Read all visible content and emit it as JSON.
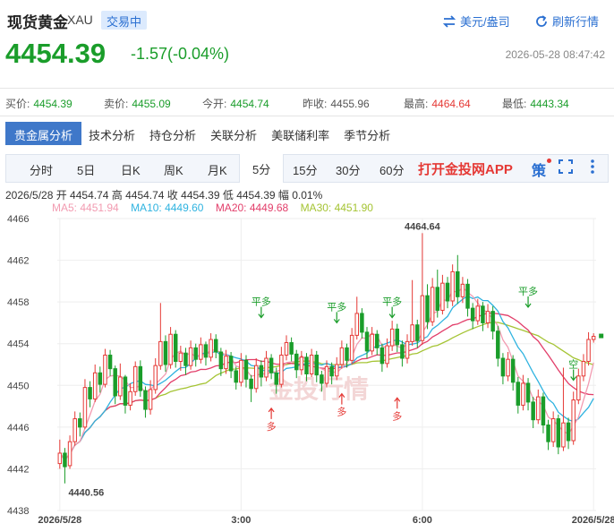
{
  "header": {
    "title": "现货黄金",
    "symbol": "XAU",
    "status": "交易中",
    "currency_link": "美元/盎司",
    "refresh_link": "刷新行情",
    "price": "4454.39",
    "change": "-1.57(-0.04%)",
    "datetime": "2026-05-28 08:47:42"
  },
  "quote": {
    "bid_label": "买价:",
    "bid": "4454.39",
    "ask_label": "卖价:",
    "ask": "4455.09",
    "open_label": "今开:",
    "open": "4454.74",
    "prev_label": "昨收:",
    "prev": "4455.96",
    "high_label": "最高:",
    "high": "4464.64",
    "low_label": "最低:",
    "low": "4443.34"
  },
  "tabs_analysis": [
    "贵金属分析",
    "技术分析",
    "持仓分析",
    "关联分析",
    "美联储利率",
    "季节分析"
  ],
  "tabs_period": [
    "分时",
    "5日",
    "日K",
    "周K",
    "月K",
    "5分",
    "15分",
    "30分",
    "60分"
  ],
  "app_link": "打开金投网APP",
  "strategy_label": "策",
  "info_line": "2026/5/28  开 4454.74  高 4454.74  收 4454.39  低 4454.39  幅 0.01%",
  "ma": {
    "ma5": "MA5: 4451.94",
    "ma10": "MA10: 4449.60",
    "ma20": "MA20: 4449.68",
    "ma30": "MA30: 4451.90"
  },
  "colors": {
    "up": "#e53935",
    "down": "#1a9d2a",
    "ma5": "#f29bb1",
    "ma10": "#2fb3e0",
    "ma20": "#e23e6a",
    "ma30": "#a5c434",
    "accent": "#2a6fd1"
  },
  "chart_data": {
    "type": "candlestick",
    "ylim": [
      4438,
      4466
    ],
    "yticks": [
      4438,
      4442,
      4446,
      4450,
      4454,
      4458,
      4462,
      4466
    ],
    "x_labels": [
      {
        "label": "2026/5/28",
        "index": 0
      },
      {
        "label": "3:00",
        "index": 36
      },
      {
        "label": "6:00",
        "index": 72
      },
      {
        "label": "2026/5/28",
        "index": 106
      }
    ],
    "max_label": "4464.64",
    "min_label": "4440.56",
    "signals": [
      {
        "text": "平多",
        "index": 40,
        "price": 4456.5,
        "dir": "down"
      },
      {
        "text": "平多",
        "index": 55,
        "price": 4456.0,
        "dir": "down"
      },
      {
        "text": "平多",
        "index": 66,
        "price": 4456.5,
        "dir": "down"
      },
      {
        "text": "平多",
        "index": 93,
        "price": 4457.5,
        "dir": "down"
      },
      {
        "text": "多",
        "index": 42,
        "price": 4447.8,
        "dir": "up"
      },
      {
        "text": "多",
        "index": 56,
        "price": 4449.2,
        "dir": "up"
      },
      {
        "text": "多",
        "index": 67,
        "price": 4448.8,
        "dir": "up"
      },
      {
        "text": "空",
        "index": 102,
        "price": 4450.5,
        "dir": "down"
      }
    ],
    "candles": [
      [
        4442.5,
        4443.5,
        4444.8,
        4442.0
      ],
      [
        4443.5,
        4442.2,
        4444.0,
        4440.6
      ],
      [
        4442.3,
        4444.6,
        4445.2,
        4442.0
      ],
      [
        4444.6,
        4446.8,
        4447.5,
        4444.2
      ],
      [
        4446.8,
        4446.0,
        4447.4,
        4445.1
      ],
      [
        4446.0,
        4449.8,
        4450.6,
        4445.8
      ],
      [
        4449.8,
        4448.7,
        4450.4,
        4447.9
      ],
      [
        4448.7,
        4451.2,
        4452.0,
        4448.4
      ],
      [
        4451.2,
        4450.1,
        4451.8,
        4449.3
      ],
      [
        4450.1,
        4452.9,
        4453.5,
        4449.8
      ],
      [
        4452.9,
        4451.6,
        4453.4,
        4450.9
      ],
      [
        4451.6,
        4449.0,
        4451.9,
        4448.2
      ],
      [
        4449.0,
        4450.8,
        4452.1,
        4448.6
      ],
      [
        4450.8,
        4448.1,
        4451.0,
        4447.3
      ],
      [
        4448.1,
        4449.4,
        4450.2,
        4447.6
      ],
      [
        4449.4,
        4451.8,
        4452.3,
        4449.0
      ],
      [
        4451.8,
        4449.5,
        4452.4,
        4448.9
      ],
      [
        4449.5,
        4447.7,
        4449.9,
        4446.9
      ],
      [
        4447.7,
        4449.6,
        4450.5,
        4447.2
      ],
      [
        4449.6,
        4451.9,
        4452.6,
        4449.2
      ],
      [
        4451.9,
        4454.2,
        4457.9,
        4451.5
      ],
      [
        4454.2,
        4452.0,
        4454.8,
        4451.3
      ],
      [
        4452.0,
        4454.9,
        4455.6,
        4451.6
      ],
      [
        4454.9,
        4452.3,
        4455.3,
        4451.7
      ],
      [
        4452.3,
        4453.1,
        4453.8,
        4451.4
      ],
      [
        4453.1,
        4451.9,
        4453.6,
        4451.0
      ],
      [
        4451.9,
        4453.6,
        4454.3,
        4451.5
      ],
      [
        4453.6,
        4452.5,
        4454.0,
        4451.8
      ],
      [
        4452.5,
        4453.9,
        4454.6,
        4452.1
      ],
      [
        4453.9,
        4452.7,
        4454.2,
        4451.9
      ],
      [
        4452.7,
        4454.4,
        4455.0,
        4452.3
      ],
      [
        4454.4,
        4453.2,
        4454.9,
        4452.6
      ],
      [
        4453.2,
        4451.6,
        4453.6,
        4450.9
      ],
      [
        4451.6,
        4452.8,
        4453.4,
        4451.1
      ],
      [
        4452.8,
        4451.4,
        4453.2,
        4450.7
      ],
      [
        4451.4,
        4450.3,
        4451.8,
        4449.6
      ],
      [
        4450.3,
        4452.4,
        4453.1,
        4449.9
      ],
      [
        4452.4,
        4450.6,
        4452.9,
        4449.8
      ],
      [
        4450.6,
        4449.7,
        4451.0,
        4448.4
      ],
      [
        4449.7,
        4451.9,
        4452.6,
        4449.3
      ],
      [
        4451.9,
        4450.8,
        4452.4,
        4449.9
      ],
      [
        4450.8,
        4452.6,
        4453.3,
        4450.4
      ],
      [
        4452.6,
        4451.2,
        4453.0,
        4450.6
      ],
      [
        4451.2,
        4450.1,
        4451.7,
        4449.2
      ],
      [
        4450.1,
        4452.9,
        4453.7,
        4449.8
      ],
      [
        4452.9,
        4454.1,
        4454.8,
        4452.4
      ],
      [
        4454.1,
        4453.0,
        4454.6,
        4452.3
      ],
      [
        4453.0,
        4451.5,
        4453.4,
        4450.7
      ],
      [
        4451.5,
        4452.7,
        4453.3,
        4451.0
      ],
      [
        4452.7,
        4451.1,
        4453.1,
        4450.4
      ],
      [
        4451.1,
        4452.9,
        4453.5,
        4450.8
      ],
      [
        4452.9,
        4451.0,
        4453.3,
        4450.3
      ],
      [
        4451.0,
        4450.2,
        4451.4,
        4449.4
      ],
      [
        4450.2,
        4451.8,
        4452.4,
        4449.8
      ],
      [
        4451.8,
        4450.9,
        4452.2,
        4450.1
      ],
      [
        4450.9,
        4452.0,
        4452.7,
        4450.5
      ],
      [
        4452.0,
        4453.6,
        4454.3,
        4451.6
      ],
      [
        4453.6,
        4452.4,
        4454.0,
        4451.7
      ],
      [
        4452.4,
        4454.8,
        4455.5,
        4452.0
      ],
      [
        4454.8,
        4456.9,
        4458.5,
        4454.4
      ],
      [
        4456.9,
        4455.1,
        4457.4,
        4454.5
      ],
      [
        4455.1,
        4453.3,
        4455.6,
        4452.6
      ],
      [
        4453.3,
        4454.9,
        4455.6,
        4452.9
      ],
      [
        4454.9,
        4453.6,
        4455.3,
        4452.9
      ],
      [
        4453.6,
        4452.1,
        4454.0,
        4451.3
      ],
      [
        4452.1,
        4453.8,
        4454.5,
        4451.7
      ],
      [
        4453.8,
        4455.4,
        4456.2,
        4453.3
      ],
      [
        4455.4,
        4453.9,
        4455.9,
        4453.2
      ],
      [
        4453.9,
        4452.6,
        4454.3,
        4451.8
      ],
      [
        4452.6,
        4454.2,
        4454.9,
        4452.1
      ],
      [
        4454.2,
        4455.8,
        4460.1,
        4453.8
      ],
      [
        4455.8,
        4454.3,
        4456.3,
        4453.6
      ],
      [
        4454.3,
        4458.6,
        4464.6,
        4453.9
      ],
      [
        4458.6,
        4456.1,
        4459.7,
        4455.4
      ],
      [
        4456.1,
        4459.4,
        4460.3,
        4455.7
      ],
      [
        4459.4,
        4457.2,
        4461.1,
        4456.5
      ],
      [
        4457.2,
        4459.8,
        4460.6,
        4456.8
      ],
      [
        4459.8,
        4458.1,
        4460.4,
        4457.4
      ],
      [
        4458.1,
        4460.9,
        4461.6,
        4457.6
      ],
      [
        4460.9,
        4458.5,
        4462.5,
        4457.8
      ],
      [
        4458.5,
        4459.7,
        4460.4,
        4457.9
      ],
      [
        4459.7,
        4457.4,
        4460.2,
        4456.6
      ],
      [
        4457.4,
        4456.2,
        4457.9,
        4455.4
      ],
      [
        4456.2,
        4457.6,
        4458.3,
        4455.8
      ],
      [
        4457.6,
        4456.0,
        4458.0,
        4455.2
      ],
      [
        4456.0,
        4457.1,
        4457.8,
        4455.5
      ],
      [
        4457.1,
        4455.2,
        4457.6,
        4454.4
      ],
      [
        4455.2,
        4452.6,
        4455.7,
        4451.8
      ],
      [
        4452.6,
        4450.9,
        4453.1,
        4450.1
      ],
      [
        4450.9,
        4452.5,
        4453.2,
        4450.4
      ],
      [
        4452.5,
        4450.3,
        4452.9,
        4449.5
      ],
      [
        4450.3,
        4448.1,
        4450.8,
        4447.3
      ],
      [
        4448.1,
        4450.2,
        4451.0,
        4447.6
      ],
      [
        4450.2,
        4448.4,
        4450.7,
        4447.6
      ],
      [
        4448.4,
        4446.7,
        4448.9,
        4445.9
      ],
      [
        4446.7,
        4448.9,
        4449.6,
        4446.3
      ],
      [
        4448.9,
        4446.2,
        4449.3,
        4445.4
      ],
      [
        4446.2,
        4444.6,
        4446.7,
        4443.8
      ],
      [
        4444.6,
        4446.8,
        4447.5,
        4444.1
      ],
      [
        4446.8,
        4444.1,
        4447.2,
        4443.4
      ],
      [
        4444.1,
        4446.4,
        4451.7,
        4443.7
      ],
      [
        4446.4,
        4444.7,
        4446.9,
        4443.9
      ],
      [
        4444.7,
        4448.6,
        4449.4,
        4444.3
      ],
      [
        4448.6,
        4450.9,
        4451.6,
        4448.2
      ],
      [
        4450.9,
        4452.3,
        4453.0,
        4450.4
      ],
      [
        4452.3,
        4454.4,
        4455.1,
        4451.9
      ],
      [
        4454.4,
        4454.7,
        4455.0,
        4454.1
      ]
    ]
  }
}
